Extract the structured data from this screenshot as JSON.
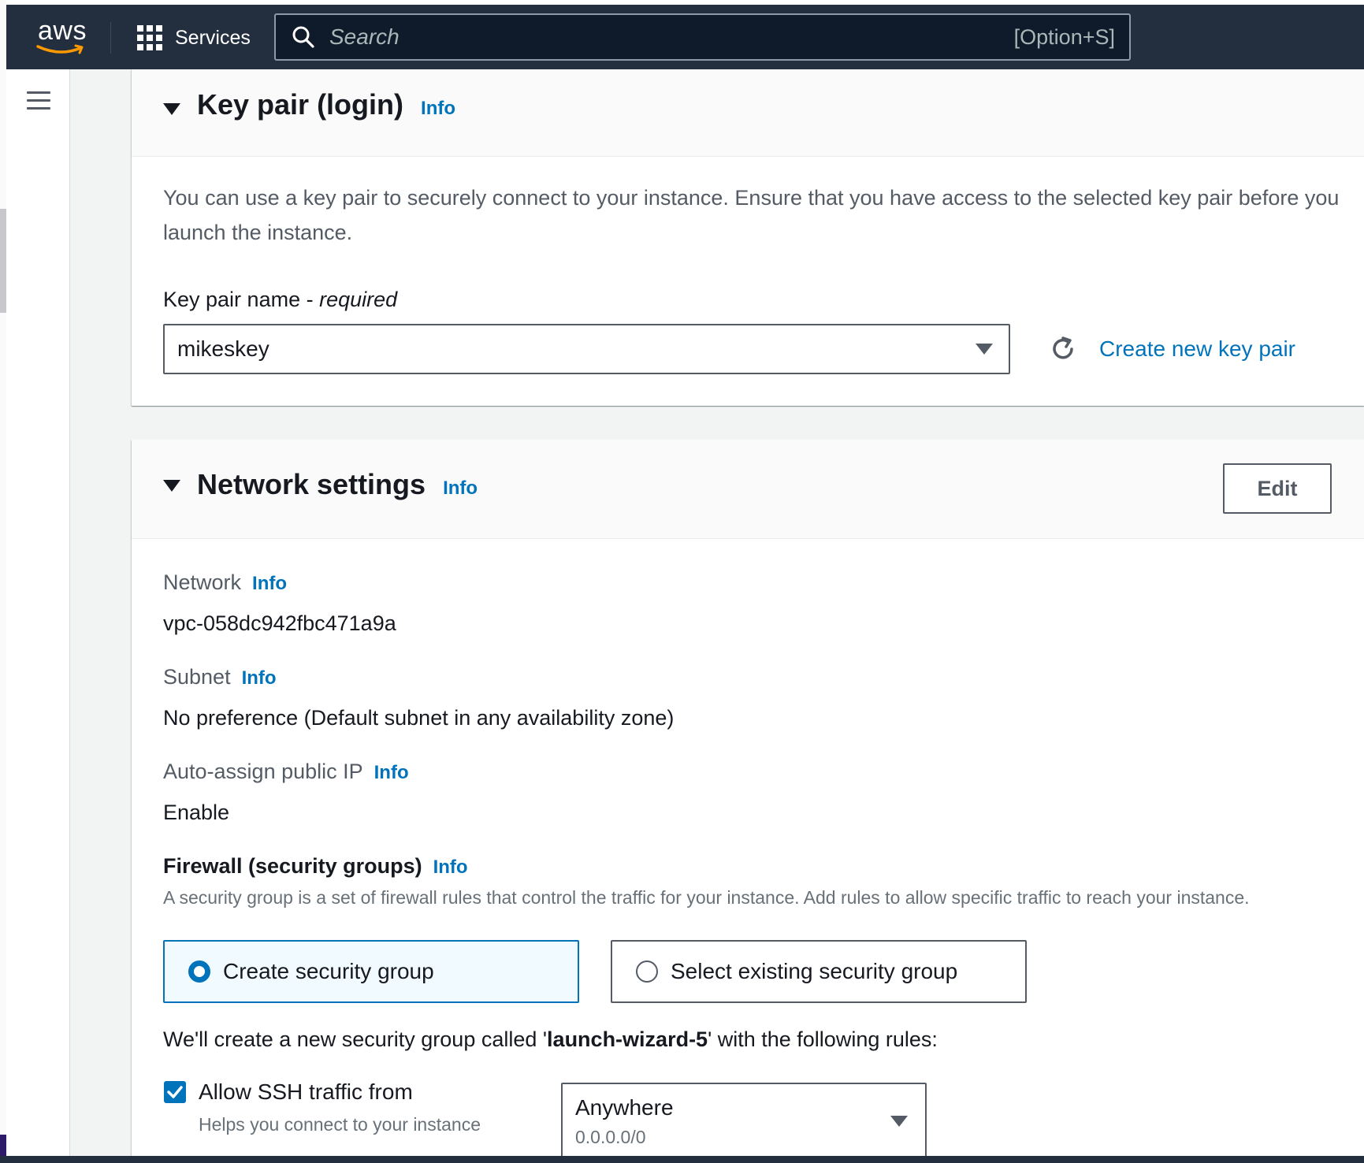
{
  "topnav": {
    "logo_text": "aws",
    "services_label": "Services",
    "search_placeholder": "Search",
    "search_shortcut": "[Option+S]"
  },
  "keypair": {
    "title": "Key pair (login)",
    "info": "Info",
    "description": "You can use a key pair to securely connect to your instance. Ensure that you have access to the selected key pair before you launch the instance.",
    "field_label": "Key pair name - ",
    "field_required": "required",
    "selected_value": "mikeskey",
    "create_link": "Create new key pair"
  },
  "network": {
    "title": "Network settings",
    "info": "Info",
    "edit_label": "Edit",
    "fields": [
      {
        "label": "Network",
        "info": "Info",
        "value": "vpc-058dc942fbc471a9a"
      },
      {
        "label": "Subnet",
        "info": "Info",
        "value": "No preference (Default subnet in any availability zone)"
      },
      {
        "label": "Auto-assign public IP",
        "info": "Info",
        "value": "Enable"
      }
    ],
    "firewall": {
      "title": "Firewall (security groups)",
      "info": "Info",
      "description": "A security group is a set of firewall rules that control the traffic for your instance. Add rules to allow specific traffic to reach your instance.",
      "options": [
        "Create security group",
        "Select existing security group"
      ],
      "selected_option": "Create security group",
      "create_text_prefix": "We'll create a new security group called '",
      "group_name": "launch-wizard-5",
      "create_text_suffix": "' with the following rules:",
      "ssh_rule": {
        "checked": true,
        "label": "Allow SSH traffic from",
        "description": "Helps you connect to your instance",
        "source": "Anywhere",
        "source_cidr": "0.0.0.0/0"
      }
    }
  },
  "colors": {
    "nav_bg": "#232f3e",
    "link": "#0073bb",
    "text": "#16191f",
    "muted": "#545b64"
  }
}
